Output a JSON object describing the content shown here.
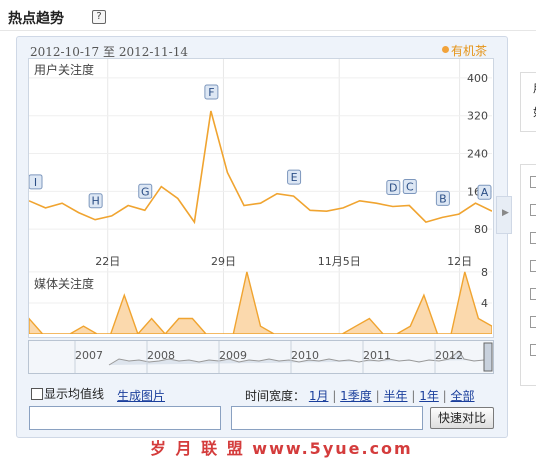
{
  "header": {
    "title": "热点趋势",
    "help_glyph": "?"
  },
  "panel": {
    "date_range": "2012-10-17 至 2012-11-14",
    "legend_label": "有机茶",
    "legend_color": "#f2a33a"
  },
  "user_chart": {
    "label": "用户关注度",
    "y_ticks": [
      "400",
      "320",
      "240",
      "160",
      "80"
    ],
    "x_ticks": [
      "22日",
      "29日",
      "11月5日",
      "12日"
    ],
    "markers": [
      "I",
      "H",
      "G",
      "F",
      "E",
      "D",
      "C",
      "B",
      "A"
    ]
  },
  "media_chart": {
    "label": "媒体关注度",
    "y_ticks": [
      "8",
      "4"
    ]
  },
  "navigator": {
    "years": [
      "2007",
      "2008",
      "2009",
      "2010",
      "2011",
      "2012"
    ]
  },
  "controls": {
    "moving_average": "显示均值线",
    "generate_image": "生成图片",
    "time_span_label": "时间宽度：",
    "spans": [
      "1月",
      "1季度",
      "半年",
      "1年",
      "全部"
    ],
    "compare_button": "快速对比",
    "input_a": "",
    "input_b": ""
  },
  "sidebar": {
    "row_letters": [
      "用",
      "如"
    ]
  },
  "watermark": "岁 月 联 盟   www.5yue.com",
  "chart_data": [
    {
      "type": "line",
      "title": "用户关注度",
      "series": [
        {
          "name": "有机茶",
          "values": [
            140,
            125,
            135,
            115,
            100,
            108,
            130,
            120,
            170,
            145,
            95,
            330,
            200,
            130,
            135,
            155,
            150,
            120,
            118,
            125,
            140,
            135,
            128,
            130,
            95,
            105,
            112,
            135,
            118
          ]
        }
      ],
      "ylim": [
        0,
        440
      ],
      "grid": true
    },
    {
      "type": "area",
      "title": "媒体关注度",
      "series": [
        {
          "name": "有机茶",
          "values": [
            2,
            0,
            0,
            0,
            1,
            0,
            0,
            5,
            0,
            2,
            0,
            2,
            2,
            0,
            0,
            0,
            8,
            1,
            0,
            0,
            0,
            0,
            0,
            0,
            1,
            2,
            0,
            0,
            1,
            5,
            0,
            0,
            8,
            2,
            1
          ]
        }
      ],
      "ylim": [
        0,
        8.5
      ],
      "grid": true
    }
  ]
}
